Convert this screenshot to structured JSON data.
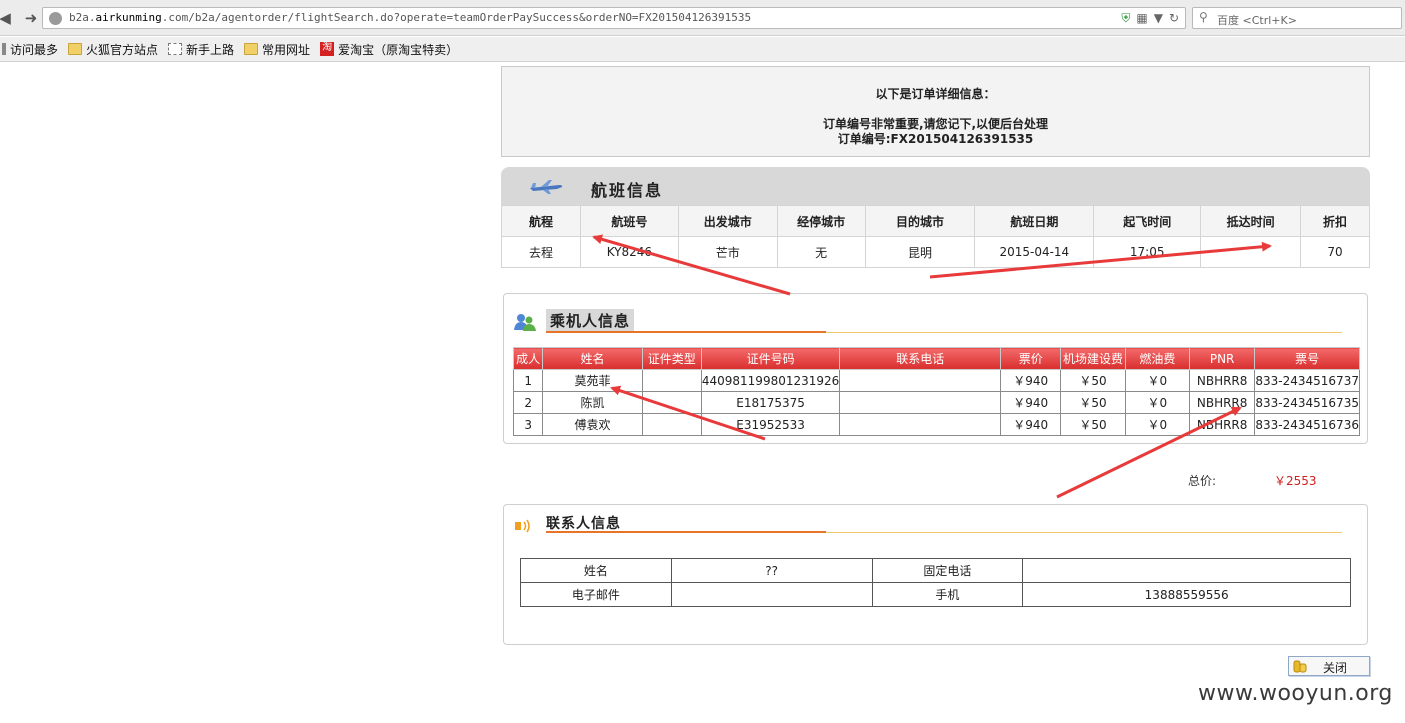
{
  "browser": {
    "url_prefix": "b2a.",
    "url_domain": "airkunming",
    "url_rest": ".com/b2a/agentorder/flightSearch.do?operate=teamOrderPaySuccess&orderNO=FX201504126391535",
    "search_placeholder": "百度 <Ctrl+K>",
    "bookmarks": [
      "访问最多",
      "火狐官方站点",
      "新手上路",
      "常用网址",
      "爱淘宝（原淘宝特卖）"
    ],
    "taobao_glyph": "淘"
  },
  "order": {
    "line1": "以下是订单详细信息：",
    "line2": "订单编号非常重要,请您记下,以便后台处理",
    "line3": "订单编号:FX201504126391535"
  },
  "flight": {
    "title": "航班信息",
    "headers": [
      "航程",
      "航班号",
      "出发城市",
      "经停城市",
      "目的城市",
      "航班日期",
      "起飞时间",
      "抵达时间",
      "折扣"
    ],
    "row": [
      "去程",
      "KY8246",
      "芒市",
      "无",
      "昆明",
      "2015-04-14",
      "17:05",
      "",
      "70"
    ]
  },
  "passengers": {
    "title": "乘机人信息",
    "headers": [
      "成人",
      "姓名",
      "证件类型",
      "证件号码",
      "联系电话",
      "票价",
      "机场建设费",
      "燃油费",
      "PNR",
      "票号"
    ],
    "rows": [
      [
        "1",
        "莫苑菲",
        "",
        "440981199801231926",
        "",
        "￥940",
        "￥50",
        "￥0",
        "NBHRR8",
        "833-2434516737"
      ],
      [
        "2",
        "陈凯",
        "",
        "E18175375",
        "",
        "￥940",
        "￥50",
        "￥0",
        "NBHRR8",
        "833-2434516735"
      ],
      [
        "3",
        "傅袁欢",
        "",
        "E31952533",
        "",
        "￥940",
        "￥50",
        "￥0",
        "NBHRR8",
        "833-2434516736"
      ]
    ]
  },
  "total": {
    "label": "总价:",
    "value": "￥2553"
  },
  "contact": {
    "title": "联系人信息",
    "rows": [
      [
        "姓名",
        "??",
        "固定电话",
        ""
      ],
      [
        "电子邮件",
        "",
        "手机",
        "13888559556"
      ]
    ]
  },
  "close_label": "关闭",
  "watermark": "www.wooyun.org",
  "colors": {
    "arrow": "#e83a3a",
    "header_red": "#d92e2e",
    "accent_orange": "#e8742a"
  }
}
